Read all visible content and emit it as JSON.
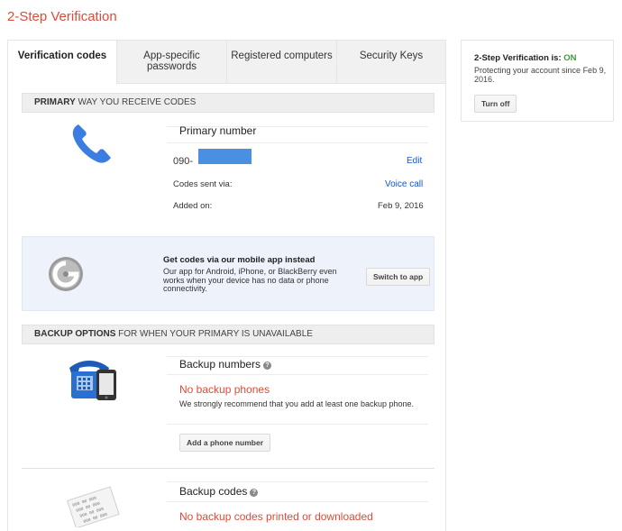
{
  "page_title": "2-Step Verification",
  "tabs": [
    {
      "label_line1": "Verification codes",
      "label_line2": ""
    },
    {
      "label_line1": "App-specific",
      "label_line2": "passwords"
    },
    {
      "label_line1": "Registered computers",
      "label_line2": ""
    },
    {
      "label_line1": "Security Keys",
      "label_line2": ""
    }
  ],
  "primary": {
    "header_bold": "PRIMARY",
    "header_rest": " WAY YOU RECEIVE CODES",
    "title": "Primary number",
    "phone_prefix": "090-",
    "edit_label": "Edit",
    "codes_sent_label": "Codes sent via:",
    "codes_sent_value": "Voice call",
    "added_label": "Added on:",
    "added_value": "Feb 9, 2016"
  },
  "app_promo": {
    "title": "Get codes via our mobile app instead",
    "description": "Our app for Android, iPhone, or BlackBerry even works when your device has no data or phone connectivity.",
    "button_label": "Switch to app"
  },
  "backup": {
    "header_bold": "BACKUP OPTIONS",
    "header_rest": " FOR WHEN YOUR PRIMARY IS UNAVAILABLE",
    "numbers_title": "Backup numbers",
    "numbers_empty": "No backup phones",
    "numbers_note": "We strongly recommend that you add at least one backup phone.",
    "add_phone_label": "Add a phone number",
    "codes_title": "Backup codes",
    "codes_empty": "No backup codes printed or downloaded",
    "paper_codes": [
      "000 00 000",
      "000 00 000",
      "000 00 000",
      "000 00 000"
    ]
  },
  "status": {
    "label": "2-Step Verification is: ",
    "value": "ON",
    "description": "Protecting your account since Feb 9, 2016.",
    "turn_off_label": "Turn off"
  },
  "colors": {
    "title_red": "#dd4b39",
    "link_blue": "#1155cc",
    "status_green": "#3c9a3c",
    "phone_blue": "#3b7de0",
    "masked_blue": "#4a90e2"
  }
}
